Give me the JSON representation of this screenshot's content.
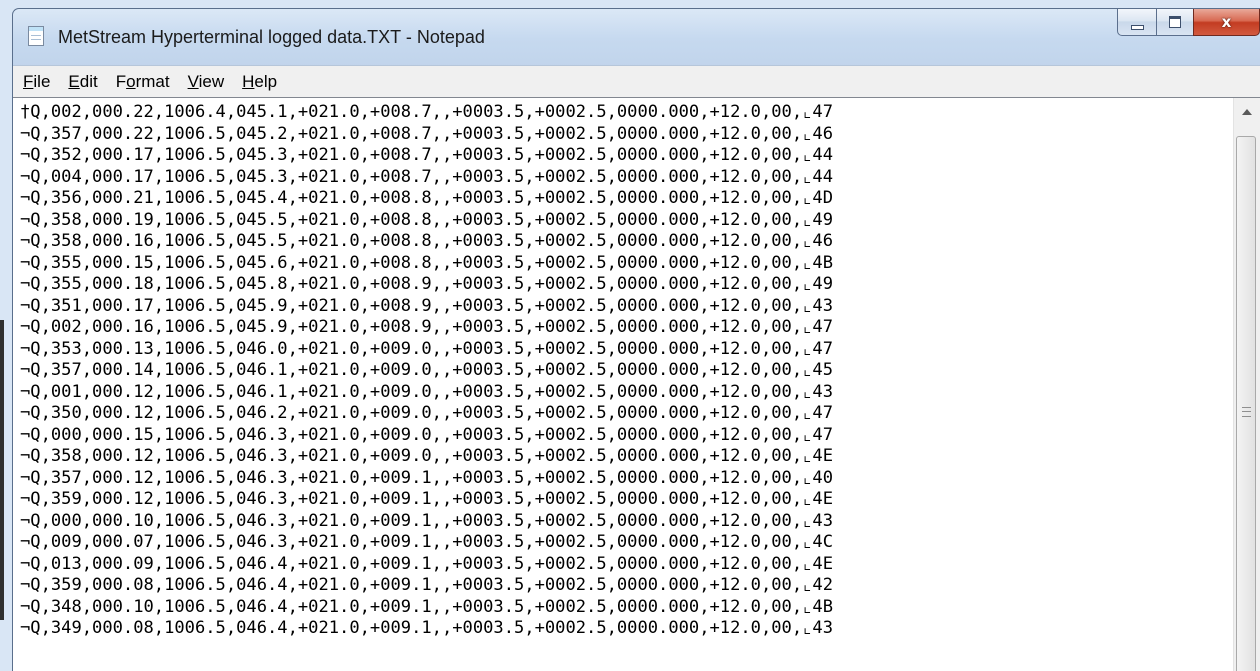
{
  "window": {
    "title": "MetStream Hyperterminal logged data.TXT - Notepad",
    "close_glyph": "x",
    "icons": {
      "app": "notepad-icon",
      "minimize": "minimize-icon",
      "maximize": "maximize-icon",
      "close": "close-icon",
      "scroll_up": "scroll-up-arrow-icon"
    }
  },
  "menu": [
    {
      "mnemonic": "F",
      "rest": "ile"
    },
    {
      "mnemonic": "E",
      "rest": "dit"
    },
    {
      "pre": "F",
      "mnemonic": "o",
      "rest": "rmat"
    },
    {
      "mnemonic": "V",
      "rest": "iew"
    },
    {
      "mnemonic": "H",
      "rest": "elp"
    }
  ],
  "lines": [
    "†Q,002,000.22,1006.4,045.1,+021.0,+008.7,,+0003.5,+0002.5,0000.000,+12.0,00,⌞47",
    "¬Q,357,000.22,1006.5,045.2,+021.0,+008.7,,+0003.5,+0002.5,0000.000,+12.0,00,⌞46",
    "¬Q,352,000.17,1006.5,045.3,+021.0,+008.7,,+0003.5,+0002.5,0000.000,+12.0,00,⌞44",
    "¬Q,004,000.17,1006.5,045.3,+021.0,+008.7,,+0003.5,+0002.5,0000.000,+12.0,00,⌞44",
    "¬Q,356,000.21,1006.5,045.4,+021.0,+008.8,,+0003.5,+0002.5,0000.000,+12.0,00,⌞4D",
    "¬Q,358,000.19,1006.5,045.5,+021.0,+008.8,,+0003.5,+0002.5,0000.000,+12.0,00,⌞49",
    "¬Q,358,000.16,1006.5,045.5,+021.0,+008.8,,+0003.5,+0002.5,0000.000,+12.0,00,⌞46",
    "¬Q,355,000.15,1006.5,045.6,+021.0,+008.8,,+0003.5,+0002.5,0000.000,+12.0,00,⌞4B",
    "¬Q,355,000.18,1006.5,045.8,+021.0,+008.9,,+0003.5,+0002.5,0000.000,+12.0,00,⌞49",
    "¬Q,351,000.17,1006.5,045.9,+021.0,+008.9,,+0003.5,+0002.5,0000.000,+12.0,00,⌞43",
    "¬Q,002,000.16,1006.5,045.9,+021.0,+008.9,,+0003.5,+0002.5,0000.000,+12.0,00,⌞47",
    "¬Q,353,000.13,1006.5,046.0,+021.0,+009.0,,+0003.5,+0002.5,0000.000,+12.0,00,⌞47",
    "¬Q,357,000.14,1006.5,046.1,+021.0,+009.0,,+0003.5,+0002.5,0000.000,+12.0,00,⌞45",
    "¬Q,001,000.12,1006.5,046.1,+021.0,+009.0,,+0003.5,+0002.5,0000.000,+12.0,00,⌞43",
    "¬Q,350,000.12,1006.5,046.2,+021.0,+009.0,,+0003.5,+0002.5,0000.000,+12.0,00,⌞47",
    "¬Q,000,000.15,1006.5,046.3,+021.0,+009.0,,+0003.5,+0002.5,0000.000,+12.0,00,⌞47",
    "¬Q,358,000.12,1006.5,046.3,+021.0,+009.0,,+0003.5,+0002.5,0000.000,+12.0,00,⌞4E",
    "¬Q,357,000.12,1006.5,046.3,+021.0,+009.1,,+0003.5,+0002.5,0000.000,+12.0,00,⌞40",
    "¬Q,359,000.12,1006.5,046.3,+021.0,+009.1,,+0003.5,+0002.5,0000.000,+12.0,00,⌞4E",
    "¬Q,000,000.10,1006.5,046.3,+021.0,+009.1,,+0003.5,+0002.5,0000.000,+12.0,00,⌞43",
    "¬Q,009,000.07,1006.5,046.3,+021.0,+009.1,,+0003.5,+0002.5,0000.000,+12.0,00,⌞4C",
    "¬Q,013,000.09,1006.5,046.4,+021.0,+009.1,,+0003.5,+0002.5,0000.000,+12.0,00,⌞4E",
    "¬Q,359,000.08,1006.5,046.4,+021.0,+009.1,,+0003.5,+0002.5,0000.000,+12.0,00,⌞42",
    "¬Q,348,000.10,1006.5,046.4,+021.0,+009.1,,+0003.5,+0002.5,0000.000,+12.0,00,⌞4B",
    "¬Q,349,000.08,1006.5,046.4,+021.0,+009.1,,+0003.5,+0002.5,0000.000,+12.0,00,⌞43"
  ]
}
